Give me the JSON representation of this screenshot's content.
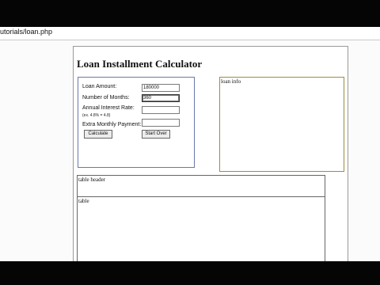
{
  "browser": {
    "url": "utorials/loan.php"
  },
  "page": {
    "title": "Loan Installment Calculator",
    "form": {
      "loan_amount_label": "Loan Amount:",
      "loan_amount_value": "180000",
      "months_label": "Number of Months:",
      "months_value": "360",
      "rate_label": "Annual Interest Rate:",
      "rate_hint": "(ex. 4.8% = 4.8)",
      "rate_value": "",
      "extra_label": "Extra Monthly Payment:",
      "extra_value": "",
      "calculate_label": "Calculate",
      "start_over_label": "Start Over"
    },
    "loan_info_label": "loan info",
    "table_header_label": "table header",
    "table_label": "table"
  }
}
